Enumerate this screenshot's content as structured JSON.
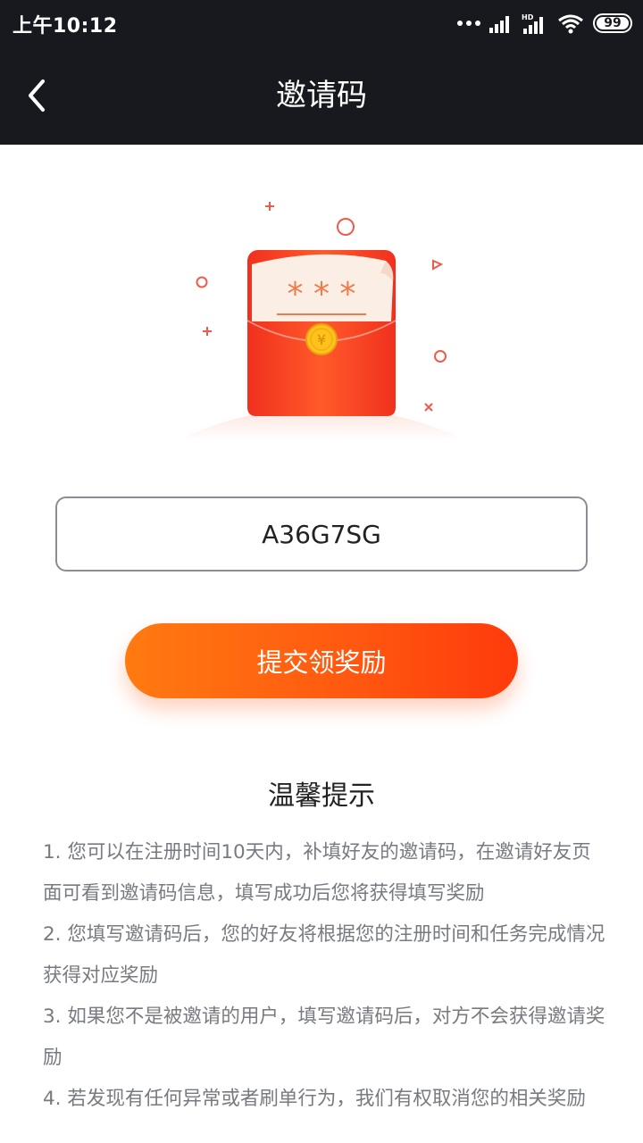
{
  "status_bar": {
    "time": "上午10:12",
    "battery": "99",
    "icons": [
      "more-dots-icon",
      "signal-icon",
      "hd-signal-icon",
      "wifi-icon",
      "battery-icon"
    ]
  },
  "nav": {
    "title": "邀请码",
    "back_icon": "chevron-left-icon"
  },
  "illustration": {
    "envelope_text": "* * *",
    "coin_symbol": "¥"
  },
  "form": {
    "invite_code_value": "A36G7SG",
    "submit_label": "提交领奖励"
  },
  "tips": {
    "title": "温馨提示",
    "items": [
      "1. 您可以在注册时间10天内，补填好友的邀请码，在邀请好友页面可看到邀请码信息，填写成功后您将获得填写奖励",
      "2. 您填写邀请码后，您的好友将根据您的注册时间和任务完成情况获得对应奖励",
      "3. 如果您不是被邀请的用户，填写邀请码后，对方不会获得邀请奖励",
      "4. 若发现有任何异常或者刷单行为，我们有权取消您的相关奖励"
    ]
  },
  "colors": {
    "nav_background": "#17191e",
    "accent_start": "#ff7a10",
    "accent_end": "#ff3a0c",
    "envelope_red": "#f5402a"
  }
}
